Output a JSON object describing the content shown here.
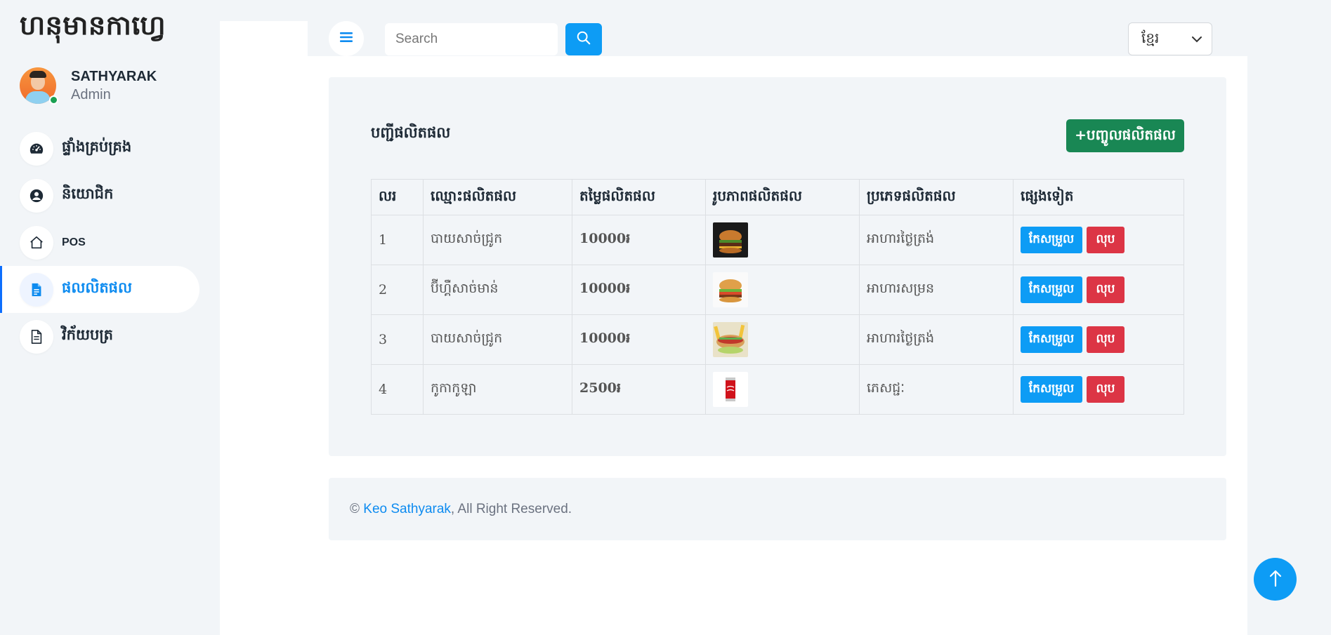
{
  "sidebar": {
    "brand": "ហនុមានកាហ្វេ",
    "profile": {
      "name": "SATHYARAK",
      "role": "Admin"
    },
    "items": [
      {
        "label": "ផ្ទាំងគ្រប់គ្រង",
        "icon": "dashboard-icon",
        "active": false
      },
      {
        "label": "និយោជិក",
        "icon": "user-circle-icon",
        "active": false
      },
      {
        "label": "POS",
        "icon": "home-icon",
        "active": false
      },
      {
        "label": "ផលលិតផល",
        "icon": "document-icon",
        "active": true
      },
      {
        "label": "វិក័យបត្រ",
        "icon": "invoice-icon",
        "active": false
      }
    ]
  },
  "header": {
    "menu_icon": "hamburger-icon",
    "search_placeholder": "Search",
    "search_icon": "search-icon",
    "language": "ខ្មែរ"
  },
  "main": {
    "title": "បញ្ជីផលិតផល",
    "add_button": "+បញ្ចូលផលិតផល",
    "table": {
      "headers": [
        "លរ",
        "ឈ្មោះផលិតផល",
        "តម្លៃផលិតផល",
        "រូបភាពផលិតផល",
        "ប្រភេទផលិតផល",
        "ផ្សេងទៀត"
      ],
      "rows": [
        {
          "no": "1",
          "name": "បាយសាច់ជ្រូក",
          "price": "10000៛",
          "image": "burger-dark",
          "category": "អាហារថ្ងៃត្រង់",
          "edit": "កែសម្រួល",
          "delete": "លុប"
        },
        {
          "no": "2",
          "name": "ប៊ីហ្គឺសាច់មាន់",
          "price": "10000៛",
          "image": "burger-light",
          "category": "អាហារសម្រន",
          "edit": "កែសម្រួល",
          "delete": "លុប"
        },
        {
          "no": "3",
          "name": "បាយសាច់ជ្រូក",
          "price": "10000៛",
          "image": "hotdog-fries",
          "category": "អាហារថ្ងៃត្រង់",
          "edit": "កែសម្រួល",
          "delete": "លុប"
        },
        {
          "no": "4",
          "name": "កូកាកូឡា",
          "price": "2500៛",
          "image": "cola-can",
          "category": "ភេសជ្ជៈ",
          "edit": "កែសម្រួល",
          "delete": "លុប"
        }
      ]
    }
  },
  "footer": {
    "prefix": "© ",
    "author": "Keo Sathyarak",
    "suffix": ", All Right Reserved."
  },
  "colors": {
    "primary": "#0d9cf5",
    "success": "#198754",
    "danger": "#dc3545",
    "background": "#f2f5f8"
  }
}
